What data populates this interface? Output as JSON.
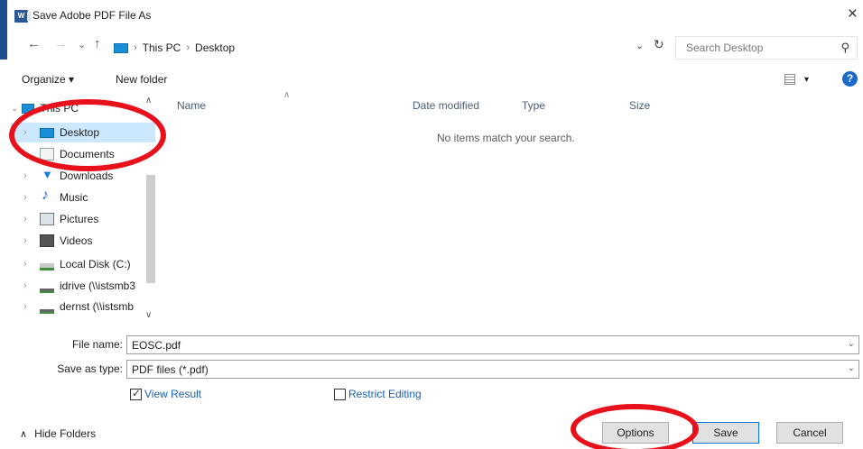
{
  "window": {
    "title": "Save Adobe PDF File As",
    "app_icon": "word-icon",
    "close_glyph": "×"
  },
  "nav": {
    "back_glyph": "←",
    "forward_glyph": "→",
    "recent_glyph": "⌄",
    "up_glyph": "↑",
    "breadcrumbs": [
      "This PC",
      "Desktop"
    ],
    "separator": "›",
    "dropdown_glyph": "⌄",
    "refresh_glyph": "↻",
    "search_placeholder": "Search Desktop",
    "search_glyph": "⚲"
  },
  "toolbar": {
    "organize_label": "Organize ▾",
    "new_folder_label": "New folder",
    "view_caret": "▾",
    "help_glyph": "?"
  },
  "tree": {
    "root_label": "This PC",
    "items": [
      {
        "label": "Desktop",
        "icon": "desktop-icon",
        "selected": true
      },
      {
        "label": "Documents",
        "icon": "documents-icon"
      },
      {
        "label": "Downloads",
        "icon": "downloads-icon"
      },
      {
        "label": "Music",
        "icon": "music-icon"
      },
      {
        "label": "Pictures",
        "icon": "pictures-icon"
      },
      {
        "label": "Videos",
        "icon": "videos-icon"
      },
      {
        "label": "Local Disk (C:)",
        "icon": "local-disk-icon"
      },
      {
        "label": "idrive (\\\\istsmb3",
        "icon": "network-drive-icon"
      },
      {
        "label": "dernst (\\\\istsmb",
        "icon": "network-drive-icon"
      }
    ],
    "chevron_glyph": "›"
  },
  "columns": [
    "Name",
    "Date modified",
    "Type",
    "Size"
  ],
  "empty_message": "No items match your search.",
  "form": {
    "file_name_label": "File name:",
    "file_name_value": "EOSC.pdf",
    "save_type_label": "Save as type:",
    "save_type_value": "PDF files (*.pdf)",
    "drop_glyph": "⌄"
  },
  "options": {
    "view_result_label": "View Result",
    "view_result_checked": true,
    "restrict_editing_label": "Restrict Editing",
    "restrict_editing_checked": false
  },
  "footer": {
    "hide_folders_label": "Hide Folders",
    "hide_folders_glyph": "∧",
    "options_button": "Options",
    "save_button": "Save",
    "cancel_button": "Cancel"
  },
  "colors": {
    "annotation_red": "#e8101a",
    "selection_blue": "#cce8ff",
    "accent": "#0078d7"
  }
}
